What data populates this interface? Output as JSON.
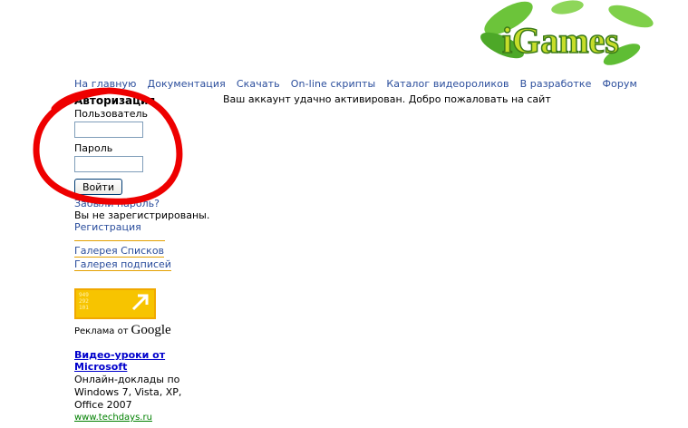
{
  "logo": {
    "text": "iGames"
  },
  "nav": [
    "На главную",
    "Документация",
    "Скачать",
    "On-line скрипты",
    "Каталог видеороликов",
    "В разработке",
    "Форум"
  ],
  "message": "Ваш аккаунт удачно активирован. Добро пожаловать на сайт",
  "auth": {
    "title": "Авторизация",
    "user_label": "Пользователь",
    "user_value": "",
    "pass_label": "Пароль",
    "pass_value": "",
    "login_button": "Войти",
    "forgot": "Забыли пароль?",
    "not_registered": "Вы не зарегистрированы.",
    "register": "Регистрация"
  },
  "galleries": [
    "Галерея Списков",
    "Галерея подписей"
  ],
  "ad": {
    "logo_digits": [
      "949",
      "292",
      "101"
    ],
    "by_label": "Реклама от",
    "google": "Google",
    "title_line1": "Видео-уроки от",
    "title_line2": "Microsoft",
    "desc_lines": [
      "Онлайн-доклады по",
      "Windows 7, Vista, XP,",
      "Office 2007"
    ],
    "url": "www.techdays.ru"
  },
  "colors": {
    "link": "#2a4d9c",
    "accent": "#e4a000",
    "annotation": "#ee0000",
    "logo_green": "#55b82a"
  }
}
